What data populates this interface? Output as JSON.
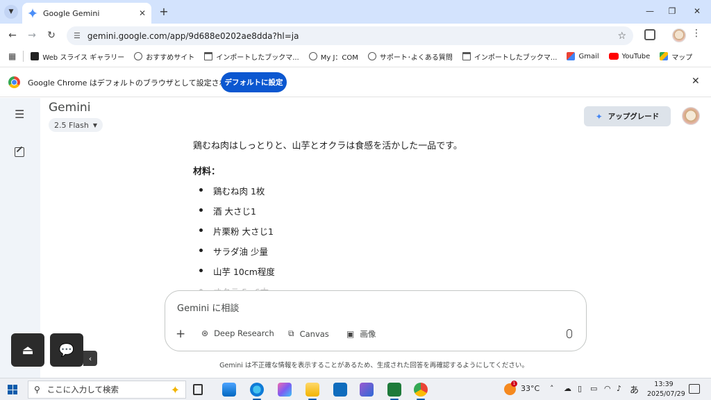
{
  "browser": {
    "tab_title": "Google Gemini",
    "url": "gemini.google.com/app/9d688e0202ae8dda?hl=ja",
    "bookmarks": [
      {
        "label": "Web スライス ギャラリー",
        "icon": "web-slice-icon"
      },
      {
        "label": "おすすめサイト",
        "icon": "globe-icon"
      },
      {
        "label": "インポートしたブックマ...",
        "icon": "folder-icon"
      },
      {
        "label": "My J：COM",
        "icon": "globe-icon"
      },
      {
        "label": "サポート･よくある質問",
        "icon": "globe-icon"
      },
      {
        "label": "インポートしたブックマ...",
        "icon": "folder-icon"
      },
      {
        "label": "Gmail",
        "icon": "gmail-icon"
      },
      {
        "label": "YouTube",
        "icon": "youtube-icon"
      },
      {
        "label": "マップ",
        "icon": "maps-icon"
      }
    ],
    "infobar": {
      "message": "Google Chrome はデフォルトのブラウザとして設定されていません",
      "button": "デフォルトに設定"
    }
  },
  "gemini": {
    "brand": "Gemini",
    "model": "2.5 Flash",
    "upgrade": "アップグレード",
    "intro": "鶏むね肉はしっとりと、山芋とオクラは食感を活かした一品です。",
    "ingredients_heading": "材料：",
    "ingredients": [
      "鶏むね肉 1枚",
      "酒 大さじ1",
      "片栗粉 大さじ1",
      "サラダ油 少量",
      "山芋 10cm程度",
      "オクラ 5~6本"
    ],
    "composer": {
      "placeholder": "Gemini に相談",
      "tools": [
        "Deep Research",
        "Canvas",
        "画像"
      ]
    },
    "disclaimer": "Gemini は不正確な情報を表示することがあるため、生成された回答を再確認するようにしてください。"
  },
  "taskbar": {
    "search_placeholder": "ここに入力して検索",
    "temperature": "33°C",
    "weather_badge": "1",
    "ime": "あ",
    "time": "13:39",
    "date": "2025/07/29"
  },
  "colors": {
    "accent": "#0b57d0",
    "tabstrip": "#d3e3fd",
    "rail": "#f0f4f9"
  }
}
